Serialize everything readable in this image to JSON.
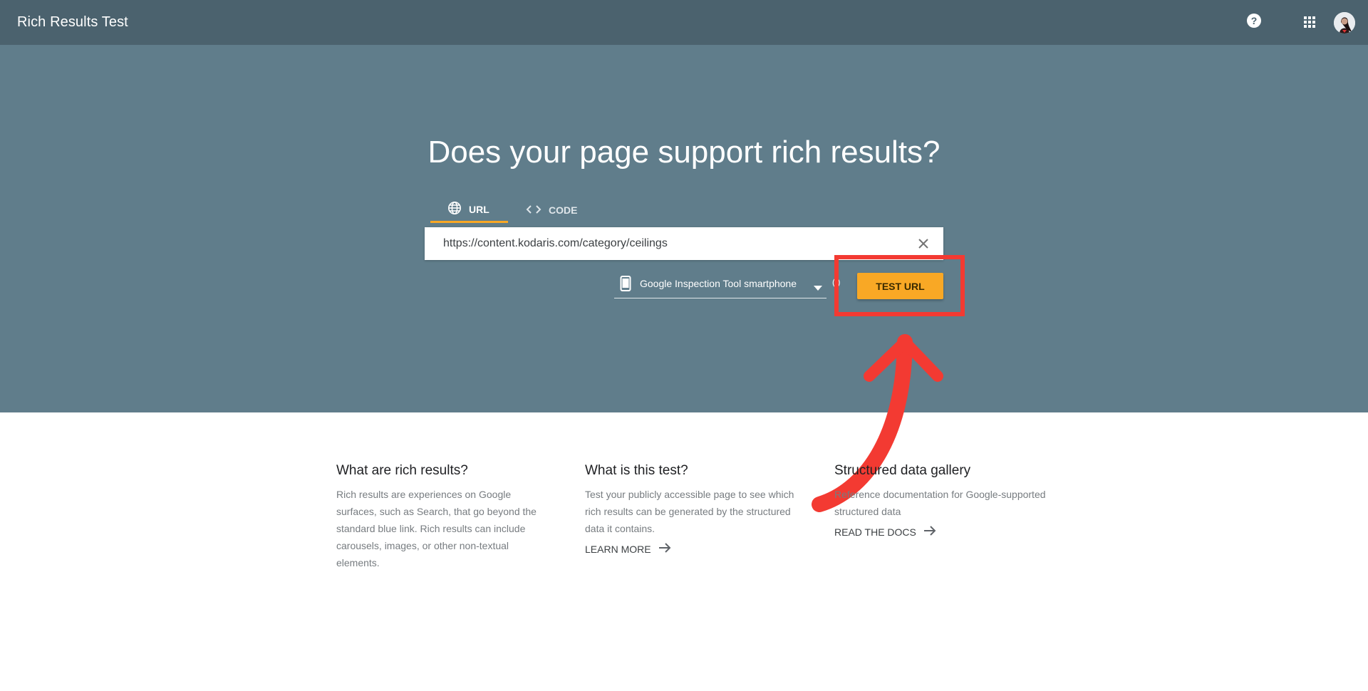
{
  "appbar": {
    "title": "Rich Results Test",
    "help_icon": "help-icon",
    "apps_icon": "apps-grid-icon",
    "avatar": "user-avatar"
  },
  "hero": {
    "headline": "Does your page support rich results?",
    "tabs": [
      {
        "label": "URL",
        "icon": "globe-icon",
        "selected": true
      },
      {
        "label": "CODE",
        "icon": "code-icon",
        "selected": false
      }
    ],
    "url_value": "https://content.kodaris.com/category/ceilings",
    "clear_icon": "close-icon",
    "user_agent": "Google Inspection Tool smartphone",
    "user_agent_icon": "smartphone-icon",
    "test_button": "TEST URL"
  },
  "info": [
    {
      "title": "What are rich results?",
      "text": "Rich results are experiences on Google surfaces, such as Search, that go beyond the standard blue link. Rich results can include carousels, images, or other non-textual elements.",
      "link": ""
    },
    {
      "title": "What is this test?",
      "text": "Test your publicly accessible page to see which rich results can be generated by the structured data it contains.",
      "link": "LEARN MORE"
    },
    {
      "title": "Structured data gallery",
      "text": "Reference documentation for Google-supported structured data",
      "link": "READ THE DOCS"
    }
  ],
  "colors": {
    "appbar": "#4b626e",
    "hero": "#607d8b",
    "accent": "#f9a825",
    "annotation": "#f33a32"
  }
}
